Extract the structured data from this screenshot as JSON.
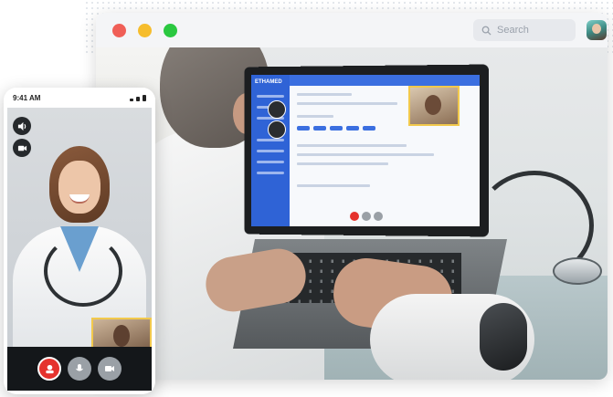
{
  "browser": {
    "search": {
      "placeholder": "Search",
      "icon": "search-icon"
    },
    "profile": {
      "icon": "avatar"
    }
  },
  "laptop_app": {
    "logo": "ETHAMED"
  },
  "phone": {
    "status_time": "9:41 AM",
    "side_controls": [
      "speaker-icon",
      "camera-icon"
    ],
    "call_controls": [
      {
        "name": "end-call-button",
        "icon": "end-call-icon",
        "color": "#e5322d"
      },
      {
        "name": "mute-button",
        "icon": "microphone-icon",
        "color": "#9aa0a6"
      },
      {
        "name": "video-button",
        "icon": "video-camera-icon",
        "color": "#9aa0a6"
      }
    ]
  },
  "colors": {
    "accent": "#2f63d6",
    "end_call": "#e5322d",
    "pip_border": "#f2c94c"
  }
}
